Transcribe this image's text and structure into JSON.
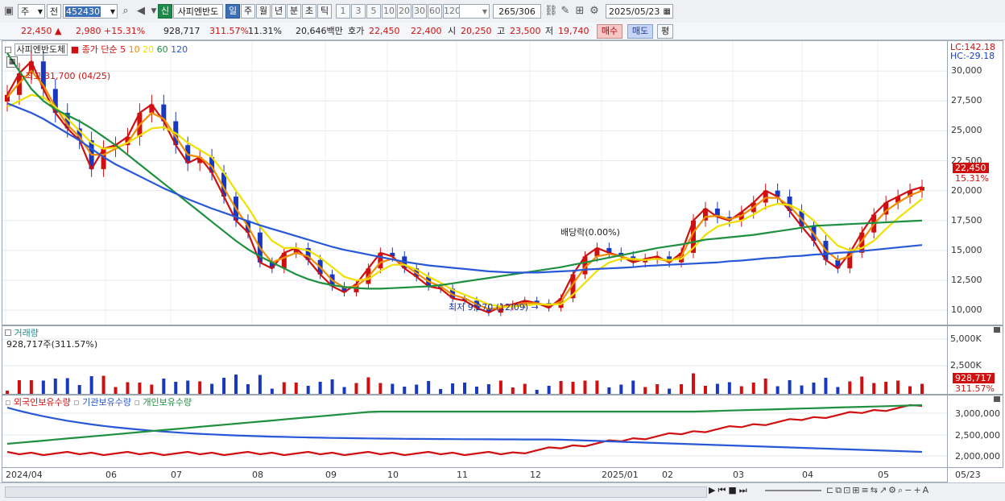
{
  "toolbar": {
    "period_select": "주",
    "prev_label": "전",
    "code": "452430",
    "new_badge": "신",
    "stock_name": "사피엔반도",
    "period_buttons": [
      "일",
      "주",
      "월",
      "년",
      "분",
      "초",
      "틱"
    ],
    "interval_buttons": [
      "1",
      "3",
      "5",
      "10",
      "20",
      "30",
      "60",
      "120"
    ],
    "count": "265",
    "total": "/306",
    "date": "2025/05/23"
  },
  "quote": {
    "price": "22,450",
    "change": "2,980 +15.31%",
    "volume": "928,717",
    "volume_ratio": "311.57%",
    "turnover_pct": "11.31%",
    "amount": "20,646백만",
    "bid_label": "호가",
    "ask_price": "22,450",
    "bid_price": "22,400",
    "open_label": "시",
    "open": "20,250",
    "high_label": "고",
    "high": "23,500",
    "low_label": "저",
    "low": "19,740",
    "buy_label": "매수",
    "sell_label": "매도",
    "eval_label": "평"
  },
  "price_panel": {
    "name": "사피엔반도체",
    "legend_prefix": "종가 단순",
    "ma_periods": [
      "5",
      "10",
      "20",
      "60",
      "120"
    ],
    "ma_colors": [
      "#d01010",
      "#f08c00",
      "#f0e000",
      "#1e9040",
      "#2858d8"
    ],
    "high_note": "최고 31,700 (04/25)",
    "low_note": "최저 9,270 (12/09)",
    "dividend_note": "배당락(0.00%)",
    "lc": "LC:142.18",
    "hc": "HC:-29.18",
    "last_tag": "22,450",
    "last_pct": "15.31%"
  },
  "volume_panel": {
    "title": "거래량",
    "value": "928,717주(311.57%)",
    "tag": "928,717",
    "tag_pct": "311.57%",
    "ticks": [
      "5,000K",
      "2,500K"
    ]
  },
  "holdings_panel": {
    "legend": [
      {
        "name": "외국인보유수량",
        "color": "#d01010"
      },
      {
        "name": "기관보유수량",
        "color": "#2858d8"
      },
      {
        "name": "개인보유수량",
        "color": "#1e9040"
      }
    ],
    "ticks": [
      "3,000,000",
      "2,500,000",
      "2,000,000"
    ]
  },
  "x_axis": [
    "2024/04",
    "06",
    "07",
    "08",
    "09",
    "10",
    "11",
    "12",
    "2025/01",
    "02",
    "03",
    "04",
    "05"
  ],
  "x_axis_right": "05/23",
  "chart_data": {
    "type": "line",
    "title": "사피엔반도체",
    "y_ticks": [
      "30,000",
      "27,500",
      "25,000",
      "22,500",
      "20,000",
      "17,500",
      "15,000",
      "12,500",
      "10,000"
    ],
    "ylim": [
      8800,
      32500
    ],
    "grid": true,
    "series": [
      {
        "name": "5",
        "color": "#d01010",
        "values": [
          28000,
          29800,
          30800,
          28500,
          26500,
          25200,
          24200,
          21800,
          23500,
          23800,
          24500,
          26500,
          27200,
          25800,
          23800,
          22300,
          22800,
          21500,
          19500,
          17500,
          16500,
          14000,
          13500,
          14800,
          15200,
          14200,
          13000,
          12000,
          11500,
          12200,
          13500,
          14800,
          14500,
          13500,
          12800,
          12000,
          11800,
          11000,
          10800,
          10200,
          9800,
          10300,
          10500,
          10800,
          10600,
          10200,
          11000,
          13000,
          14500,
          15200,
          14800,
          14500,
          14000,
          14300,
          14500,
          14000,
          14800,
          17500,
          18500,
          17800,
          17500,
          18200,
          19000,
          20000,
          19500,
          18300,
          17000,
          15800,
          14200,
          13500,
          14800,
          16500,
          18000,
          19000,
          19500,
          20000,
          20300
        ]
      },
      {
        "name": "10",
        "color": "#f08c00",
        "values": [
          27800,
          29000,
          30000,
          28800,
          27000,
          25500,
          24500,
          23000,
          23000,
          23500,
          24000,
          25500,
          26500,
          26000,
          24500,
          23000,
          22800,
          22000,
          20200,
          18500,
          17000,
          15200,
          14000,
          14400,
          14800,
          14500,
          13600,
          12500,
          11900,
          12000,
          12800,
          14000,
          14300,
          13800,
          13100,
          12400,
          12000,
          11300,
          11000,
          10500,
          10100,
          10200,
          10400,
          10600,
          10600,
          10400,
          10700,
          12200,
          13600,
          14500,
          14700,
          14500,
          14200,
          14200,
          14300,
          14100,
          14500,
          16500,
          17800,
          17900,
          17600,
          17900,
          18600,
          19400,
          19400,
          18700,
          17600,
          16400,
          15000,
          14200,
          14500,
          15800,
          17200,
          18300,
          19000,
          19600,
          20000
        ]
      },
      {
        "name": "20",
        "color": "#f0e000",
        "values": [
          27000,
          27500,
          28000,
          27800,
          27000,
          26000,
          25000,
          24000,
          23500,
          23600,
          24000,
          24600,
          25200,
          25300,
          24800,
          24000,
          23400,
          22800,
          21500,
          20000,
          18600,
          17000,
          15800,
          15200,
          15200,
          15000,
          14400,
          13600,
          12800,
          12500,
          12600,
          13300,
          13800,
          13800,
          13400,
          12800,
          12300,
          11700,
          11300,
          10900,
          10500,
          10300,
          10300,
          10400,
          10500,
          10500,
          10500,
          11300,
          12300,
          13300,
          14000,
          14300,
          14300,
          14200,
          14300,
          14200,
          14300,
          15200,
          16300,
          17000,
          17300,
          17500,
          18000,
          18600,
          18900,
          18800,
          18300,
          17500,
          16400,
          15400,
          15000,
          15200,
          15800,
          16800,
          17700,
          18500,
          19300
        ]
      },
      {
        "name": "60",
        "color": "#1e9040",
        "values": [
          31500,
          30000,
          28500,
          27500,
          26800,
          26300,
          25800,
          25200,
          24500,
          23800,
          23000,
          22200,
          21400,
          20600,
          19800,
          19000,
          18200,
          17400,
          16600,
          15800,
          15100,
          14500,
          14000,
          13500,
          13000,
          12600,
          12300,
          12100,
          11950,
          11850,
          11800,
          11800,
          11850,
          11900,
          11950,
          12000,
          12100,
          12250,
          12400,
          12550,
          12700,
          12850,
          13000,
          13150,
          13300,
          13450,
          13600,
          13800,
          14000,
          14200,
          14400,
          14600,
          14800,
          15000,
          15200,
          15350,
          15500,
          15700,
          15900,
          16000,
          16100,
          16200,
          16300,
          16450,
          16600,
          16750,
          16900,
          17050,
          17100,
          17150,
          17200,
          17250,
          17300,
          17350,
          17400,
          17450,
          17500
        ]
      },
      {
        "name": "120",
        "color": "#2858d8",
        "values": [
          27300,
          26900,
          26500,
          26000,
          25400,
          24800,
          24200,
          23500,
          22800,
          22200,
          21700,
          21200,
          20700,
          20200,
          19750,
          19300,
          18900,
          18500,
          18150,
          17800,
          17450,
          17100,
          16800,
          16500,
          16200,
          15900,
          15600,
          15300,
          15050,
          14850,
          14650,
          14450,
          14250,
          14050,
          13900,
          13750,
          13650,
          13550,
          13450,
          13350,
          13250,
          13200,
          13150,
          13150,
          13150,
          13200,
          13250,
          13300,
          13400,
          13450,
          13500,
          13550,
          13600,
          13700,
          13750,
          13800,
          13850,
          13900,
          13950,
          14000,
          14100,
          14150,
          14250,
          14350,
          14400,
          14500,
          14550,
          14650,
          14700,
          14800,
          14850,
          14950,
          15050,
          15150,
          15250,
          15350,
          15450
        ]
      }
    ]
  }
}
